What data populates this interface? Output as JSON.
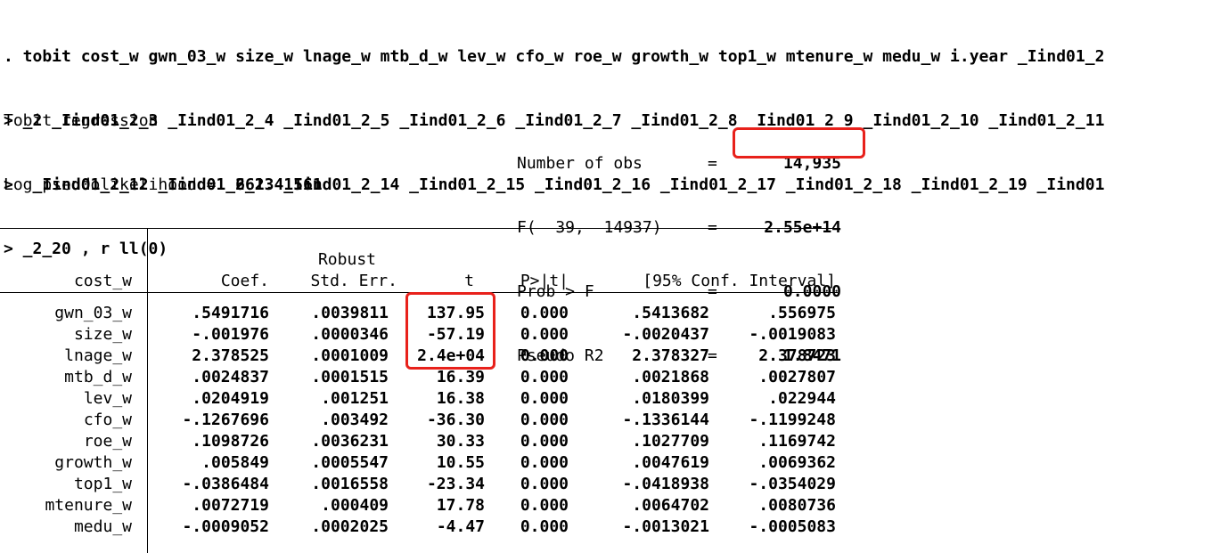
{
  "command_lines": [
    ". tobit cost_w gwn_03_w size_w lnage_w mtb_d_w lev_w cfo_w roe_w growth_w top1_w mtenure_w medu_w i.year _Iind01_2",
    "> _2 _Iind01_2_3 _Iind01_2_4 _Iind01_2_5 _Iind01_2_6 _Iind01_2_7 _Iind01_2_8 _Iind01_2_9 _Iind01_2_10 _Iind01_2_11",
    ">  _Iind01_2_12 _Iind01_2_13 _Iind01_2_14 _Iind01_2_15 _Iind01_2_16 _Iind01_2_17 _Iind01_2_18 _Iind01_2_19 _Iind01",
    "> _2_20 , r ll(0)"
  ],
  "header": {
    "title": "Tobit regression",
    "loglik_label": "Log pseudolikelihood =",
    "loglik_value": "662.41561",
    "stats": [
      {
        "label": "Number of obs",
        "eq": "=",
        "value": "14,935"
      },
      {
        "label": "F(  39,  14937)",
        "eq": "=",
        "value": "2.55e+14"
      },
      {
        "label": "Prob > F",
        "eq": "=",
        "value": "0.0000"
      },
      {
        "label": "Pseudo R2",
        "eq": "=",
        "value": "1.8471"
      }
    ]
  },
  "table": {
    "depvar": "cost_w",
    "robust_label": "Robust",
    "columns": [
      "Coef.",
      "Std. Err.",
      "t",
      "P>|t|",
      "[95% Conf. Interval]"
    ],
    "rows": [
      {
        "var": "gwn_03_w",
        "coef": ".5491716",
        "se": ".0039811",
        "t": "137.95",
        "p": "0.000",
        "lo": ".5413682",
        "hi": ".556975"
      },
      {
        "var": "size_w",
        "coef": "-.001976",
        "se": ".0000346",
        "t": "-57.19",
        "p": "0.000",
        "lo": "-.0020437",
        "hi": "-.0019083"
      },
      {
        "var": "lnage_w",
        "coef": "2.378525",
        "se": ".0001009",
        "t": "2.4e+04",
        "p": "0.000",
        "lo": "2.378327",
        "hi": "2.378723"
      },
      {
        "var": "mtb_d_w",
        "coef": ".0024837",
        "se": ".0001515",
        "t": "16.39",
        "p": "0.000",
        "lo": ".0021868",
        "hi": ".0027807"
      },
      {
        "var": "lev_w",
        "coef": ".0204919",
        "se": ".001251",
        "t": "16.38",
        "p": "0.000",
        "lo": ".0180399",
        "hi": ".022944"
      },
      {
        "var": "cfo_w",
        "coef": "-.1267696",
        "se": ".003492",
        "t": "-36.30",
        "p": "0.000",
        "lo": "-.1336144",
        "hi": "-.1199248"
      },
      {
        "var": "roe_w",
        "coef": ".1098726",
        "se": ".0036231",
        "t": "30.33",
        "p": "0.000",
        "lo": ".1027709",
        "hi": ".1169742"
      },
      {
        "var": "growth_w",
        "coef": ".005849",
        "se": ".0005547",
        "t": "10.55",
        "p": "0.000",
        "lo": ".0047619",
        "hi": ".0069362"
      },
      {
        "var": "top1_w",
        "coef": "-.0386484",
        "se": ".0016558",
        "t": "-23.34",
        "p": "0.000",
        "lo": "-.0418938",
        "hi": "-.0354029"
      },
      {
        "var": "mtenure_w",
        "coef": ".0072719",
        "se": ".000409",
        "t": "17.78",
        "p": "0.000",
        "lo": ".0064702",
        "hi": ".0080736"
      },
      {
        "var": "medu_w",
        "coef": "-.0009052",
        "se": ".0002025",
        "t": "-4.47",
        "p": "0.000",
        "lo": "-.0013021",
        "hi": "-.0005083"
      }
    ]
  },
  "highlight_color": "#e8211b"
}
